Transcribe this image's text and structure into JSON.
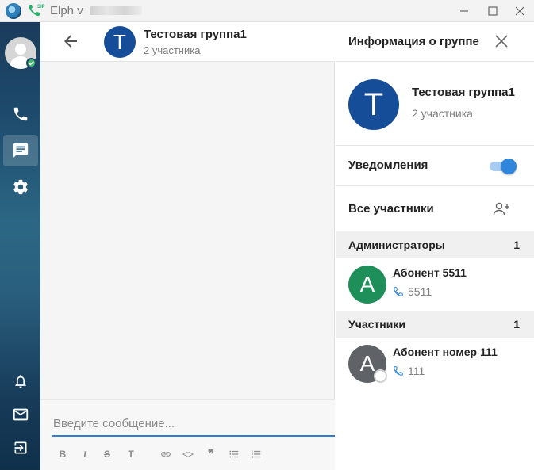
{
  "window": {
    "title": "Elph v",
    "controls": {
      "minimize": "—",
      "maximize": "☐",
      "close": "✕"
    }
  },
  "sidebar": {
    "items": [
      {
        "name": "calls",
        "icon": "phone-icon"
      },
      {
        "name": "chats",
        "icon": "chat-icon",
        "active": true
      },
      {
        "name": "settings",
        "icon": "gear-icon"
      }
    ],
    "bottom_items": [
      {
        "name": "notifications",
        "icon": "bell-icon"
      },
      {
        "name": "mail",
        "icon": "mail-icon"
      },
      {
        "name": "logout",
        "icon": "logout-icon"
      }
    ],
    "status": "online"
  },
  "chat": {
    "avatar_letter": "T",
    "title": "Тестовая группа1",
    "subtitle": "2 участника",
    "input_placeholder": "Введите сообщение...",
    "format_buttons": {
      "bold": "B",
      "italic": "I",
      "strike": "S",
      "text": "T",
      "code": "<>",
      "quote": "❞"
    }
  },
  "info": {
    "title": "Информация о группе",
    "group": {
      "avatar_letter": "T",
      "name": "Тестовая группа1",
      "count": "2 участника"
    },
    "notifications_label": "Уведомления",
    "notifications_enabled": true,
    "all_members_label": "Все участники",
    "sections": [
      {
        "label": "Администраторы",
        "count": "1",
        "members": [
          {
            "letter": "A",
            "name": "Абонент 5511",
            "phone": "5511",
            "avatar_color": "#1f8f5a"
          }
        ]
      },
      {
        "label": "Участники",
        "count": "1",
        "members": [
          {
            "letter": "A",
            "name": "Абонент номер 111",
            "phone": "111",
            "avatar_color": "#5f6368"
          }
        ]
      }
    ]
  },
  "colors": {
    "accent": "#2f7fd6",
    "group_avatar": "#154d98",
    "toggle_on": "#2f86da",
    "online": "#3fb86b"
  }
}
